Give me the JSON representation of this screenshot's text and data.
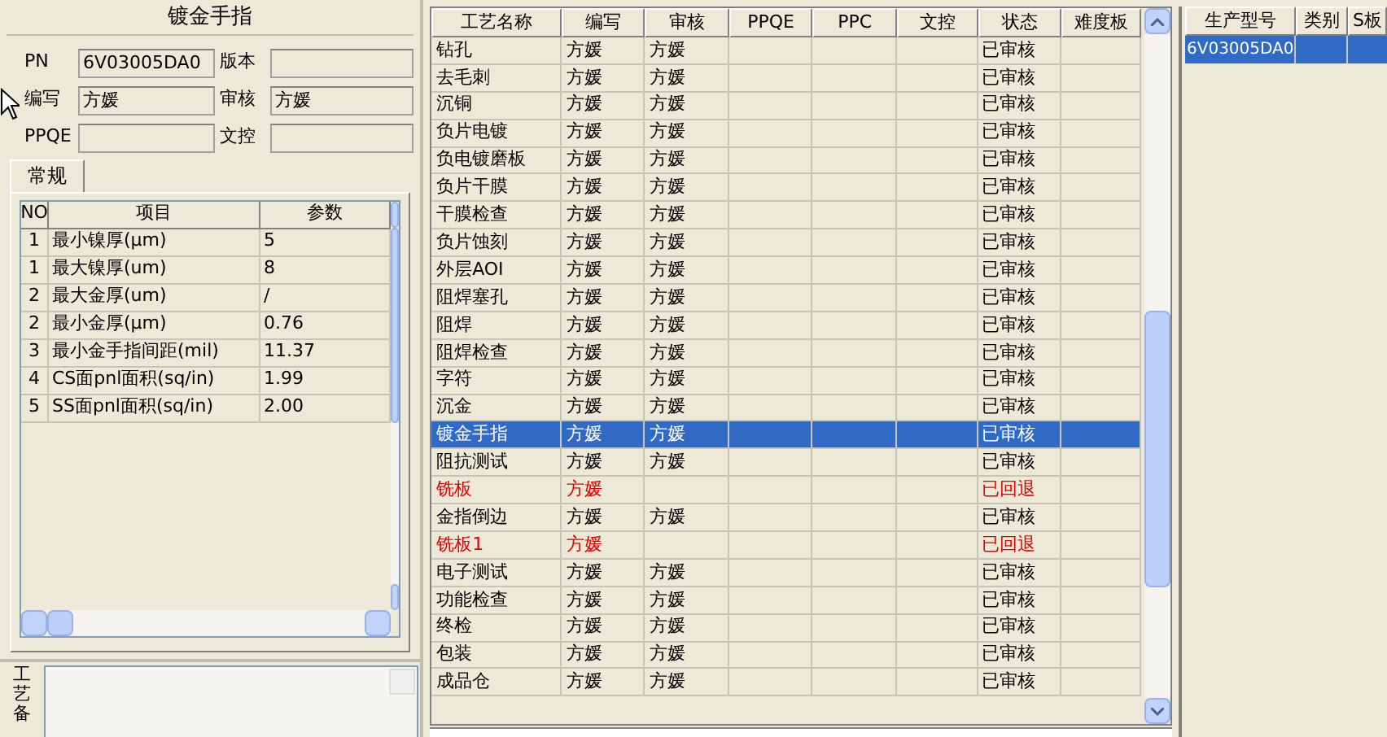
{
  "left_panel": {
    "title": "镀金手指",
    "fields": [
      {
        "label": "PN",
        "value": "6V03005DA0"
      },
      {
        "label": "版本"
      },
      {
        "label": "编写",
        "value": "方媛"
      },
      {
        "label": "审核",
        "value": "方媛"
      },
      {
        "label": "PPQE"
      },
      {
        "label": "文控"
      }
    ],
    "tabs": [
      {
        "label": "常规",
        "selected": true
      }
    ],
    "params": {
      "columns": [
        "NO",
        "项目",
        "参数"
      ],
      "rows": [
        [
          "1",
          "最小镍厚(μm)",
          "5"
        ],
        [
          "1",
          "最大镍厚(um)",
          "8"
        ],
        [
          "2",
          "最大金厚(um)",
          "/"
        ],
        [
          "2",
          "最小金厚(μm)",
          "0.76"
        ],
        [
          "3",
          "最小金手指间距(mil)",
          "11.37"
        ],
        [
          "4",
          "CS面pnl面积(sq/in)",
          "1.99"
        ],
        [
          "5",
          "SS面pnl面积(sq/in)",
          "2.00"
        ]
      ]
    },
    "remarks_label": "工艺备"
  },
  "process_table": {
    "columns": [
      "工艺名称",
      "编写",
      "审核",
      "PPQE",
      "PPC",
      "文控",
      "状态",
      "难度板"
    ],
    "rows": [
      {
        "name": "钻孔",
        "writer": "方媛",
        "reviewer": "方媛",
        "status": "已审核",
        "returned": false,
        "selected": false
      },
      {
        "name": "去毛刺",
        "writer": "方媛",
        "reviewer": "方媛",
        "status": "已审核",
        "returned": false,
        "selected": false
      },
      {
        "name": "沉铜",
        "writer": "方媛",
        "reviewer": "方媛",
        "status": "已审核",
        "returned": false,
        "selected": false
      },
      {
        "name": "负片电镀",
        "writer": "方媛",
        "reviewer": "方媛",
        "status": "已审核",
        "returned": false,
        "selected": false
      },
      {
        "name": "负电镀磨板",
        "writer": "方媛",
        "reviewer": "方媛",
        "status": "已审核",
        "returned": false,
        "selected": false
      },
      {
        "name": "负片干膜",
        "writer": "方媛",
        "reviewer": "方媛",
        "status": "已审核",
        "returned": false,
        "selected": false
      },
      {
        "name": "干膜检查",
        "writer": "方媛",
        "reviewer": "方媛",
        "status": "已审核",
        "returned": false,
        "selected": false
      },
      {
        "name": "负片蚀刻",
        "writer": "方媛",
        "reviewer": "方媛",
        "status": "已审核",
        "returned": false,
        "selected": false
      },
      {
        "name": "外层AOI",
        "writer": "方媛",
        "reviewer": "方媛",
        "status": "已审核",
        "returned": false,
        "selected": false
      },
      {
        "name": "阻焊塞孔",
        "writer": "方媛",
        "reviewer": "方媛",
        "status": "已审核",
        "returned": false,
        "selected": false
      },
      {
        "name": "阻焊",
        "writer": "方媛",
        "reviewer": "方媛",
        "status": "已审核",
        "returned": false,
        "selected": false
      },
      {
        "name": "阻焊检查",
        "writer": "方媛",
        "reviewer": "方媛",
        "status": "已审核",
        "returned": false,
        "selected": false
      },
      {
        "name": "字符",
        "writer": "方媛",
        "reviewer": "方媛",
        "status": "已审核",
        "returned": false,
        "selected": false
      },
      {
        "name": "沉金",
        "writer": "方媛",
        "reviewer": "方媛",
        "status": "已审核",
        "returned": false,
        "selected": false
      },
      {
        "name": "镀金手指",
        "writer": "方媛",
        "reviewer": "方媛",
        "status": "已审核",
        "returned": false,
        "selected": true
      },
      {
        "name": "阻抗测试",
        "writer": "方媛",
        "reviewer": "方媛",
        "status": "已审核",
        "returned": false,
        "selected": false
      },
      {
        "name": "铣板",
        "writer": "方媛",
        "status": "已回退",
        "returned": true,
        "selected": false
      },
      {
        "name": "金指倒边",
        "writer": "方媛",
        "reviewer": "方媛",
        "status": "已审核",
        "returned": false,
        "selected": false
      },
      {
        "name": "铣板1",
        "writer": "方媛",
        "status": "已回退",
        "returned": true,
        "selected": false
      },
      {
        "name": "电子测试",
        "writer": "方媛",
        "reviewer": "方媛",
        "status": "已审核",
        "returned": false,
        "selected": false
      },
      {
        "name": "功能检查",
        "writer": "方媛",
        "reviewer": "方媛",
        "status": "已审核",
        "returned": false,
        "selected": false
      },
      {
        "name": "终检",
        "writer": "方媛",
        "reviewer": "方媛",
        "status": "已审核",
        "returned": false,
        "selected": false
      },
      {
        "name": "包装",
        "writer": "方媛",
        "reviewer": "方媛",
        "status": "已审核",
        "returned": false,
        "selected": false
      },
      {
        "name": "成品仓",
        "writer": "方媛",
        "reviewer": "方媛",
        "status": "已审核",
        "returned": false,
        "selected": false
      }
    ]
  },
  "model_table": {
    "columns": [
      "生产型号",
      "类别",
      "S板"
    ],
    "rows": [
      {
        "model": "6V03005DA0",
        "selected": true
      }
    ]
  }
}
